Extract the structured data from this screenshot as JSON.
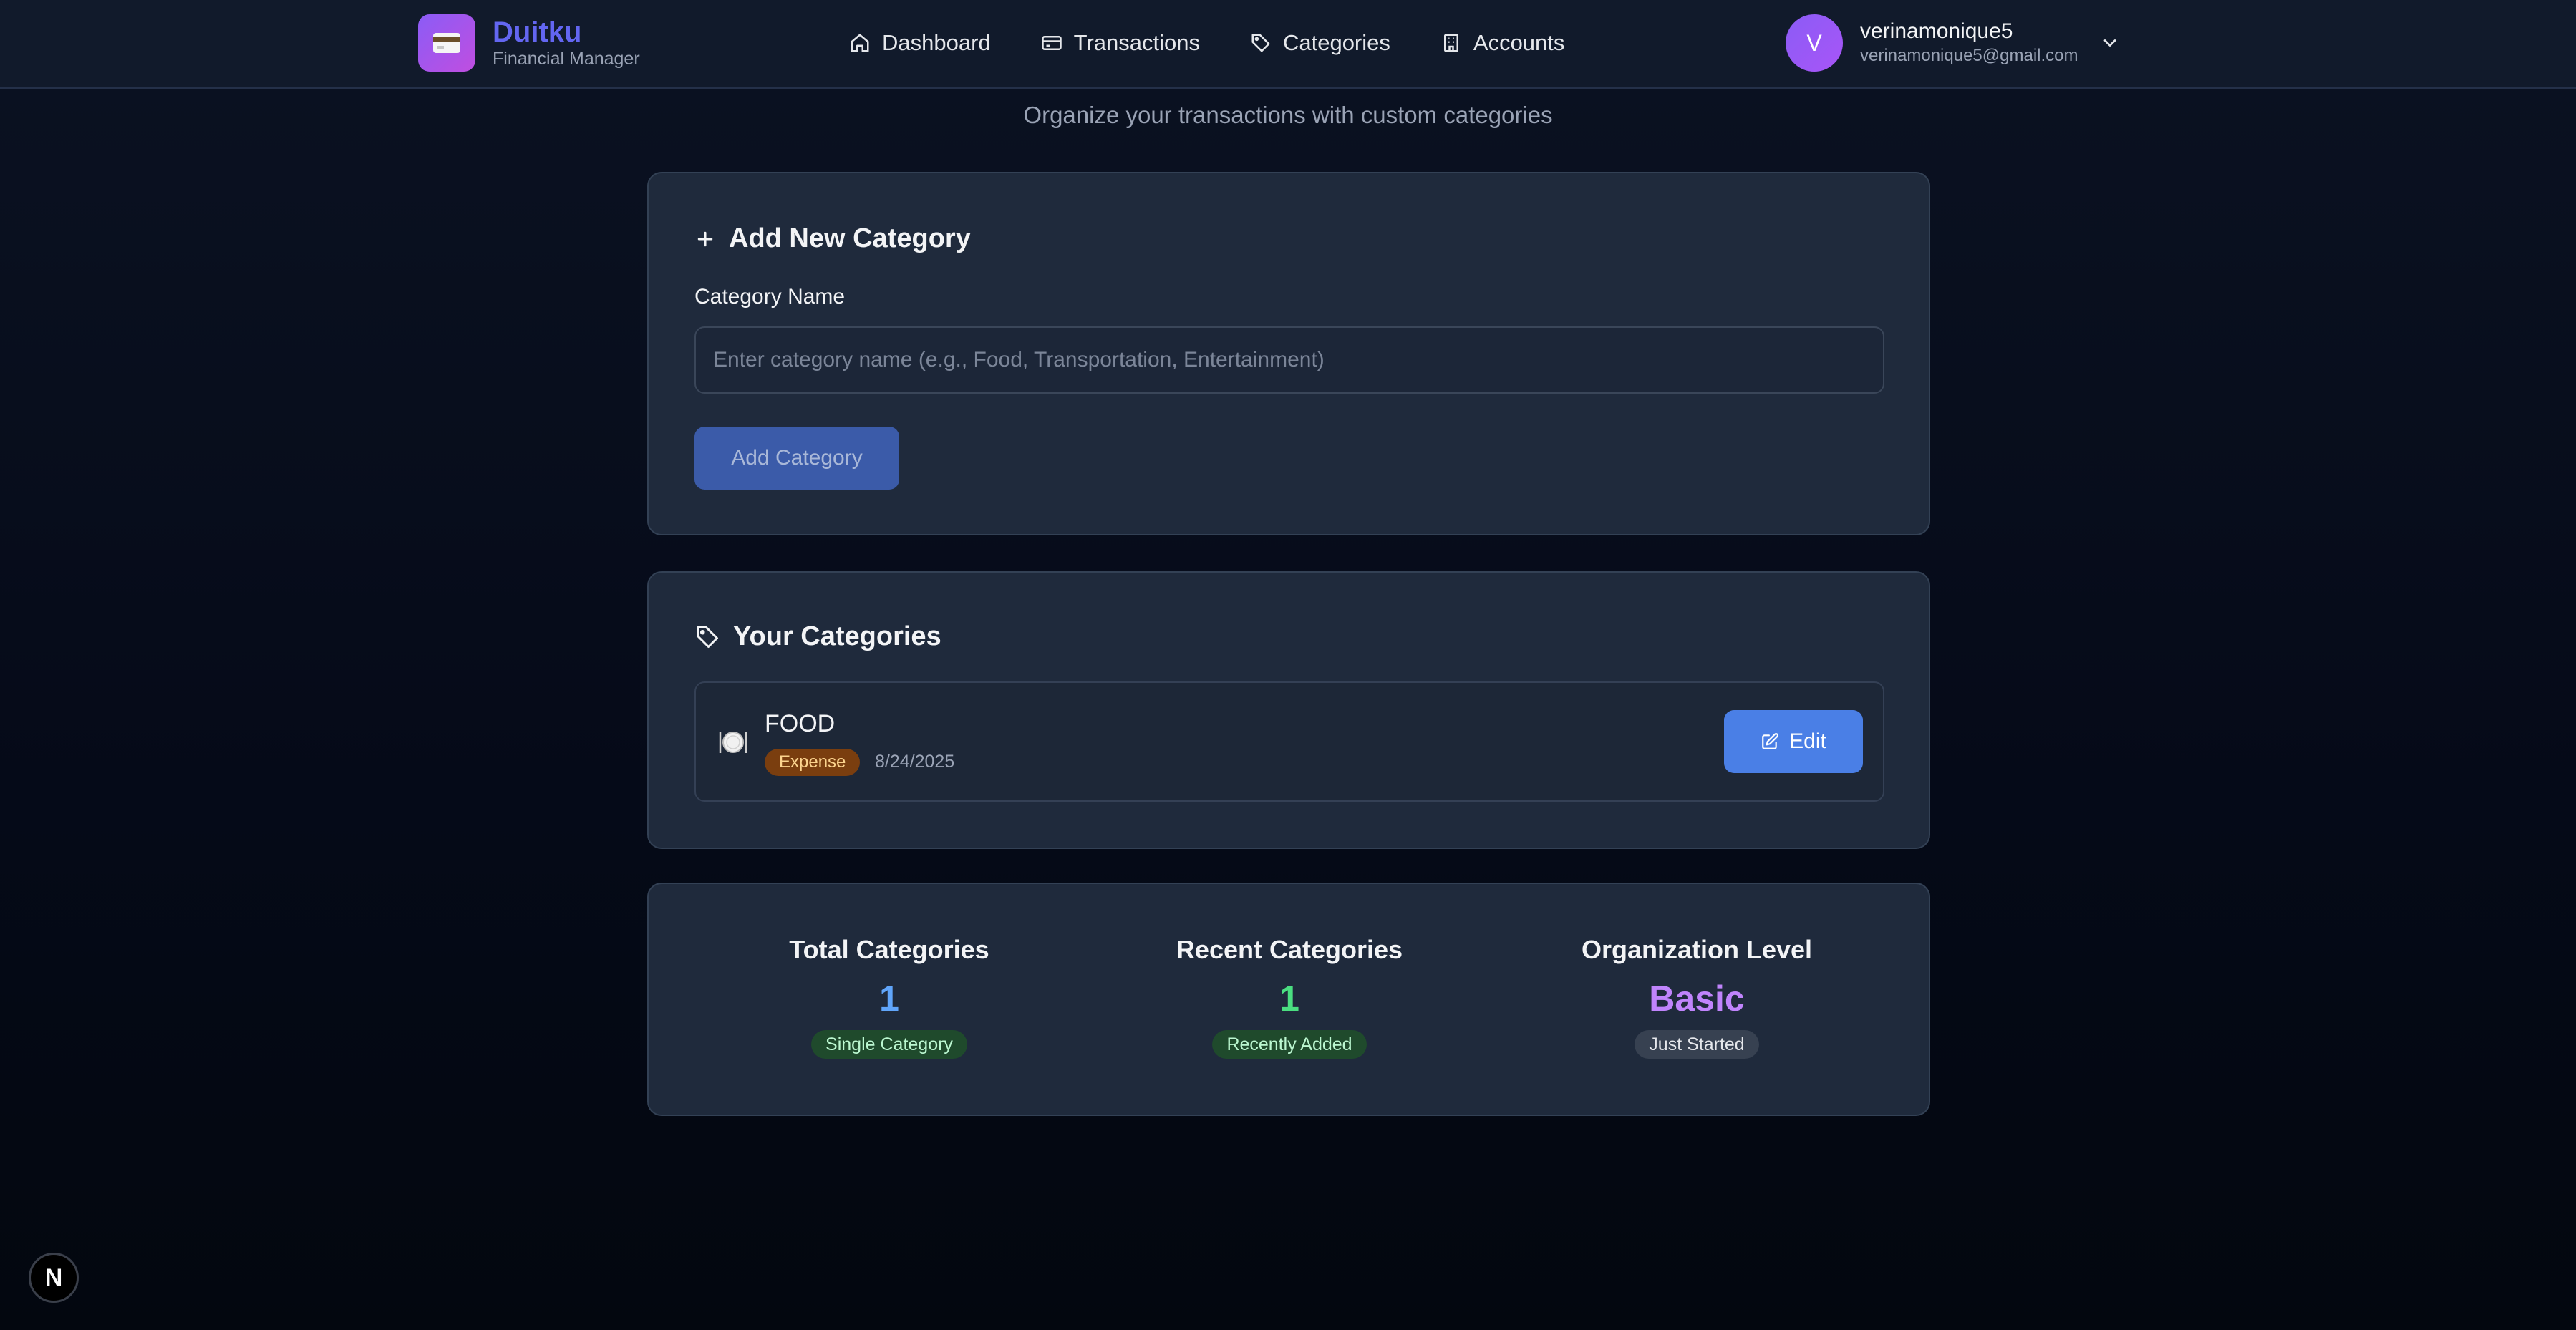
{
  "brand": {
    "name": "Duitku",
    "subtitle": "Financial Manager"
  },
  "nav": [
    {
      "label": "Dashboard",
      "icon": "home-icon"
    },
    {
      "label": "Transactions",
      "icon": "card-icon"
    },
    {
      "label": "Categories",
      "icon": "tag-icon"
    },
    {
      "label": "Accounts",
      "icon": "building-icon"
    }
  ],
  "user": {
    "initial": "V",
    "name": "verinamonique5",
    "email": "verinamonique5@gmail.com"
  },
  "page": {
    "subtitle": "Organize your transactions with custom categories"
  },
  "add_form": {
    "title": "Add New Category",
    "label": "Category Name",
    "placeholder": "Enter category name (e.g., Food, Transportation, Entertainment)",
    "value": "",
    "button": "Add Category"
  },
  "categories": {
    "title": "Your Categories",
    "items": [
      {
        "icon": "plate-icon",
        "name": "FOOD",
        "type": "Expense",
        "date": "8/24/2025",
        "edit_label": "Edit"
      }
    ]
  },
  "stats": [
    {
      "label": "Total Categories",
      "value": "1",
      "badge": "Single Category",
      "color": "#60a5fa",
      "badge_bg": "#1f4a2c",
      "badge_fg": "#bbf7d0"
    },
    {
      "label": "Recent Categories",
      "value": "1",
      "badge": "Recently Added",
      "color": "#4ade80",
      "badge_bg": "#1f4a2c",
      "badge_fg": "#bbf7d0"
    },
    {
      "label": "Organization Level",
      "value": "Basic",
      "badge": "Just Started",
      "color": "#c084fc",
      "badge_bg": "#374151",
      "badge_fg": "#e5e7eb"
    }
  ],
  "fab": {
    "label": "N"
  },
  "colors": {
    "accent": "#6366f1",
    "edit": "#4a7fe6",
    "expense_badge": "#7a3e0f"
  }
}
